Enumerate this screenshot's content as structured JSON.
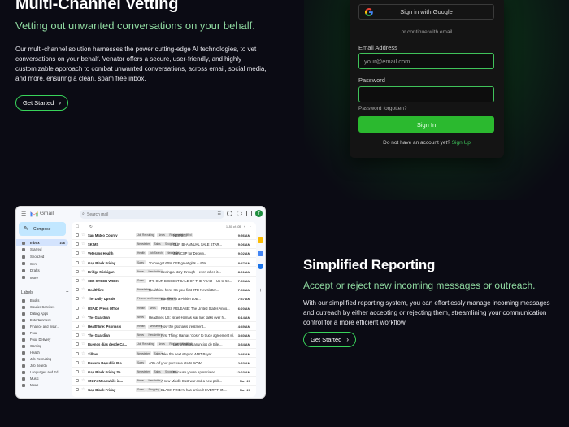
{
  "hero": {
    "title": "Multi-Channel Vetting",
    "subtitle": "Vetting out unwanted conversations on your behalf.",
    "body": "Our multi-channel solution harnesses the power cutting-edge AI technologies, to vet conversations on your behalf. Venator offers a secure, user-friendly, and highly customizable approach to combat unwanted conversations, across email, social media, and more, ensuring a clean, spam free inbox.",
    "cta": "Get Started"
  },
  "login": {
    "google_label": "Sign in with Google",
    "or_text": "or continue with email",
    "email_label": "Email Address",
    "email_placeholder": "your@email.com",
    "password_label": "Password",
    "forgot": "Password forgotten?",
    "signin": "Sign In",
    "no_account": "Do not have an account yet?",
    "signup": "Sign Up"
  },
  "gmail": {
    "app_name": "Gmail",
    "search_placeholder": "Search mail",
    "avatar": "T",
    "compose": "Compose",
    "pagination": "1–50 of 405",
    "nav": [
      {
        "label": "Inbox",
        "count": "10k"
      },
      {
        "label": "Starred",
        "count": ""
      },
      {
        "label": "Snoozed",
        "count": ""
      },
      {
        "label": "Sent",
        "count": ""
      },
      {
        "label": "Drafts",
        "count": ""
      },
      {
        "label": "More",
        "count": ""
      }
    ],
    "labels_title": "Labels",
    "labels": [
      "Books",
      "Courier Services",
      "Dating Apps",
      "Entertainment",
      "Finance and Insur...",
      "Food",
      "Food Delivery",
      "Gaming",
      "Health",
      "Job Recruiting",
      "Job Search",
      "Languages and Ed...",
      "Music",
      "News"
    ],
    "emails": [
      {
        "sender": "San Mateo County",
        "tags": [
          "Job Recruiting",
          "News",
          "Recipient Identified"
        ],
        "subject": "NEWS:...",
        "time": "9:56 AM"
      },
      {
        "sender": "SKIMS",
        "tags": [
          "Newsletter",
          "Sales",
          "Shopping"
        ],
        "subject": "OUR BI-ANNUAL SALE STAR...",
        "time": "9:06 AM"
      },
      {
        "sender": "Veterans Health",
        "tags": [
          "Health",
          "Job Search",
          "Newsletter"
        ],
        "subject": "Join CSP for Decem...",
        "time": "9:02 AM"
      },
      {
        "sender": "Gap Black Friday",
        "tags": [
          "Sales"
        ],
        "subject": "You've got 60% OFF great gifts + 40%...",
        "time": "8:47 AM"
      },
      {
        "sender": "Bridge Michigan",
        "tags": [
          "News",
          "Newsletter"
        ],
        "subject": "Seeing a story through – even when it...",
        "time": "8:01 AM"
      },
      {
        "sender": "CB2 CYBER WEEK",
        "tags": [
          "Sales"
        ],
        "subject": "IT'S OUR BIGGEST SALE OF THE YEAR – Up to 50...",
        "time": "7:59 AM"
      },
      {
        "sender": "Healthline",
        "tags": [
          "Newsletter"
        ],
        "subject": "Healthline here! It's your first 2TD Newsletter...",
        "time": "7:56 AM"
      },
      {
        "sender": "The Daily Upside",
        "tags": [
          "Finance and Insurance",
          "News"
        ],
        "subject": "Bankers in a Pickle! Low...",
        "time": "7:37 AM"
      },
      {
        "sender": "USAID Press Office",
        "tags": [
          "Health",
          "News"
        ],
        "subject": "PRESS RELEASE: The United States Anno...",
        "time": "6:20 AM"
      },
      {
        "sender": "The Guardian",
        "tags": [
          "News"
        ],
        "subject": "Headlines US: Israel-Hamas war live: talks over h...",
        "time": "6:14 AM"
      },
      {
        "sender": "Healthline: Psoriasis",
        "tags": [
          "Health",
          "Newsletter"
        ],
        "subject": "How the psoriasis treatment...",
        "time": "4:49 AM"
      },
      {
        "sender": "The Guardian",
        "tags": [
          "News",
          "Newsletter"
        ],
        "subject": "First Thing: Hamas 'close' to truce agreement wi...",
        "time": "3:40 AM"
      },
      {
        "sender": "Buenos días desde Ca...",
        "tags": [
          "Job Recruiting",
          "News",
          "Recipient Identified"
        ],
        "subject": "Los primeros anuncios de Bilei...",
        "time": "3:34 AM"
      },
      {
        "sender": "Zillow",
        "tags": [
          "Newsletter",
          "Sales"
        ],
        "subject": "Take the next step on 4487 Bayar...",
        "time": "2:46 AM"
      },
      {
        "sender": "Banana Republic Bla...",
        "tags": [
          "Sales"
        ],
        "subject": "40% off your purchase starts NOW!",
        "time": "2:33 AM"
      },
      {
        "sender": "Gap Black Friday Sa...",
        "tags": [
          "Newsletter",
          "Sales",
          "Shopping"
        ],
        "subject": "Because you're Appreciated...",
        "time": "12:23 AM"
      },
      {
        "sender": "CNN's Meanwhile in...",
        "tags": [
          "News",
          "Newsletter"
        ],
        "subject": "A new Middle East war and a new polit...",
        "time": "Nov 20"
      },
      {
        "sender": "Gap Black Friday",
        "tags": [
          "Sales",
          "Shopping"
        ],
        "subject": "BLACK FRIDAY has arrived! EVERYTHIN...",
        "time": "Nov 20"
      }
    ]
  },
  "reporting": {
    "title": "Simplified Reporting",
    "subtitle": "Accept or reject new incoming messages or outreach.",
    "body": "With our simplified reporting system, you can effortlessly manage incoming messages and outreach by either accepting or rejecting them, streamlining your communication control for a more efficient workflow.",
    "cta": "Get Started"
  },
  "colors": {
    "accent": "#2bb92f",
    "background": "#0b0b14",
    "subtitle": "#8fd9a0"
  }
}
